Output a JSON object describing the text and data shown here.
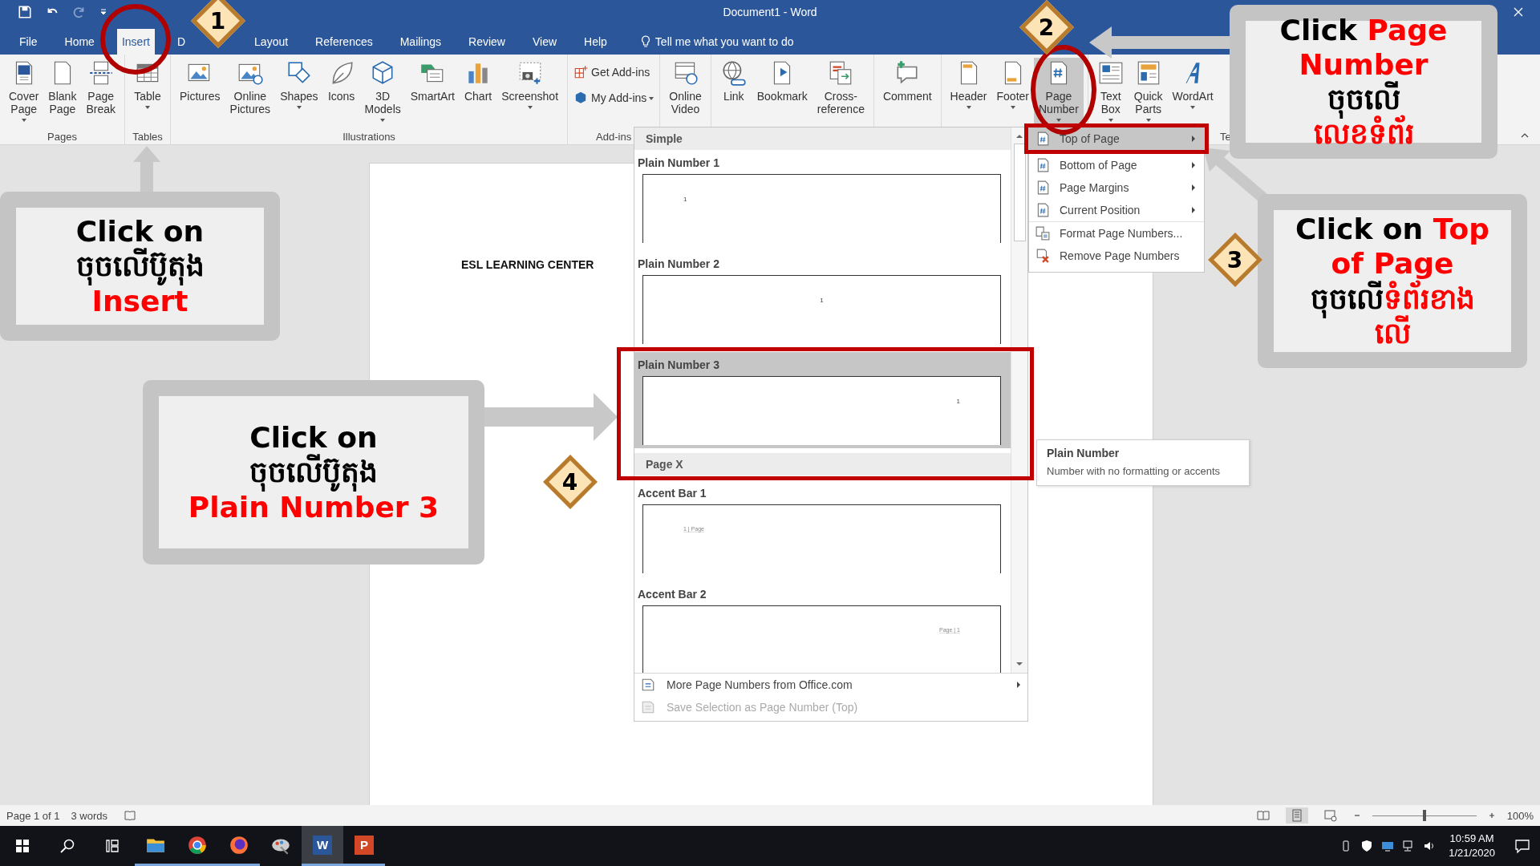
{
  "title_bar": {
    "title": "Document1  -  Word"
  },
  "tabs": [
    {
      "label": "File",
      "selected": false
    },
    {
      "label": "Home",
      "selected": false
    },
    {
      "label": "Insert",
      "selected": true
    },
    {
      "label": "D",
      "selected": false
    },
    {
      "label": "Layout",
      "selected": false
    },
    {
      "label": "References",
      "selected": false
    },
    {
      "label": "Mailings",
      "selected": false
    },
    {
      "label": "Review",
      "selected": false
    },
    {
      "label": "View",
      "selected": false
    },
    {
      "label": "Help",
      "selected": false
    }
  ],
  "tell_me": {
    "text": "Tell me what you want to do"
  },
  "ribbon": [
    {
      "label": "Pages",
      "kind": "large",
      "buttons": [
        {
          "label": "Cover Page",
          "dropdown": true,
          "pressed": false
        },
        {
          "label": "Blank Page",
          "dropdown": false,
          "pressed": false
        },
        {
          "label": "Page Break",
          "dropdown": false,
          "pressed": false
        }
      ]
    },
    {
      "label": "Tables",
      "kind": "large",
      "buttons": [
        {
          "label": "Table",
          "dropdown": true,
          "pressed": false
        }
      ]
    },
    {
      "label": "Illustrations",
      "kind": "large",
      "buttons": [
        {
          "label": "Pictures",
          "dropdown": false,
          "pressed": false
        },
        {
          "label": "Online Pictures",
          "dropdown": false,
          "pressed": false
        },
        {
          "label": "Shapes",
          "dropdown": true,
          "pressed": false
        },
        {
          "label": "Icons",
          "dropdown": false,
          "pressed": false
        },
        {
          "label": "3D Models",
          "dropdown": true,
          "pressed": false
        },
        {
          "label": "SmartArt",
          "dropdown": false,
          "pressed": false
        },
        {
          "label": "Chart",
          "dropdown": false,
          "pressed": false
        },
        {
          "label": "Screenshot",
          "dropdown": true,
          "pressed": false
        }
      ]
    },
    {
      "label": "Add-ins",
      "kind": "small",
      "buttons": [
        {
          "label": "Get Add-ins",
          "dropdown": false,
          "pressed": false
        },
        {
          "label": "My Add-ins",
          "dropdown": true,
          "pressed": false
        }
      ]
    },
    {
      "kind": "large",
      "buttons": [
        {
          "label": "Online Video",
          "dropdown": false,
          "pressed": false
        }
      ]
    },
    {
      "kind": "large",
      "buttons": [
        {
          "label": "Link",
          "dropdown": false,
          "pressed": false
        },
        {
          "label": "Bookmark",
          "dropdown": false,
          "pressed": false
        },
        {
          "label": "Cross-reference",
          "dropdown": false,
          "pressed": false
        }
      ]
    },
    {
      "kind": "large",
      "buttons": [
        {
          "label": "Comment",
          "dropdown": false,
          "pressed": false
        }
      ]
    },
    {
      "kind": "large",
      "buttons": [
        {
          "label": "Header",
          "dropdown": true,
          "pressed": false
        },
        {
          "label": "Footer",
          "dropdown": true,
          "pressed": false
        },
        {
          "label": "Page Number",
          "dropdown": true,
          "pressed": true
        }
      ]
    },
    {
      "label": "Te",
      "kind": "large",
      "buttons": [
        {
          "label": "Text Box",
          "dropdown": true,
          "pressed": false
        },
        {
          "label": "Quick Parts",
          "dropdown": true,
          "pressed": false
        },
        {
          "label": "WordArt",
          "dropdown": true,
          "pressed": false
        }
      ]
    }
  ],
  "document": {
    "text": "ESL LEARNING CENTER"
  },
  "gallery": {
    "sections": [
      {
        "title": "Simple",
        "items": [
          {
            "title": "Plain Number 1",
            "kind": "left",
            "preview": "1",
            "selected": false
          },
          {
            "title": "Plain Number 2",
            "kind": "center",
            "preview": "1",
            "selected": false
          },
          {
            "title": "Plain Number 3",
            "kind": "right",
            "preview": "1",
            "selected": true
          }
        ]
      },
      {
        "title": "Page X",
        "items": [
          {
            "title": "Accent Bar 1",
            "kind": "accent-left",
            "preview": "1 | Page",
            "selected": false
          },
          {
            "title": "Accent Bar 2",
            "kind": "accent-right",
            "preview": "Page | 1",
            "selected": false
          }
        ]
      }
    ],
    "footer": [
      {
        "label": "More Page Numbers from Office.com",
        "disabled": false,
        "submenu": true
      },
      {
        "label": "Save Selection as Page Number (Top)",
        "disabled": true,
        "submenu": false
      }
    ]
  },
  "submenu": [
    {
      "label": "Top of Page",
      "kind": "position",
      "selected": true,
      "submenu": true
    },
    {
      "label": "Bottom of Page",
      "kind": "position",
      "selected": false,
      "submenu": true
    },
    {
      "label": "Page Margins",
      "kind": "position",
      "selected": false,
      "submenu": true
    },
    {
      "label": "Current Position",
      "kind": "position",
      "selected": false,
      "submenu": true
    },
    {
      "label": "Format Page Numbers...",
      "kind": "format",
      "selected": false,
      "submenu": false
    },
    {
      "label": "Remove Page Numbers",
      "kind": "remove",
      "selected": false,
      "submenu": false
    }
  ],
  "tooltip": {
    "title": "Plain Number",
    "text": "Number with no formatting or accents"
  },
  "callouts": [
    {
      "lines": [
        [
          {
            "text": "Click on",
            "accent": false
          }
        ],
        [
          {
            "text": "ចុចលើប៊ូតុង",
            "accent": false
          }
        ],
        [
          {
            "text": "Insert",
            "accent": true
          }
        ]
      ]
    },
    {
      "lines": [
        [
          {
            "text": "Click ",
            "accent": false
          },
          {
            "text": "Page",
            "accent": true
          }
        ],
        [
          {
            "text": "Number",
            "accent": true
          }
        ],
        [
          {
            "text": "ចុចលើ",
            "accent": false
          }
        ],
        [
          {
            "text": "លេខទំព័រ",
            "accent": true
          }
        ]
      ]
    },
    {
      "lines": [
        [
          {
            "text": "Click on ",
            "accent": false
          },
          {
            "text": "Top",
            "accent": true
          }
        ],
        [
          {
            "text": "of Page",
            "accent": true
          }
        ],
        [
          {
            "text": "ចុចលើ",
            "accent": false
          },
          {
            "text": "ទំព័រខាង",
            "accent": true
          }
        ],
        [
          {
            "text": "លើ",
            "accent": true
          }
        ]
      ]
    },
    {
      "lines": [
        [
          {
            "text": "Click on",
            "accent": false
          }
        ],
        [
          {
            "text": "ចុចលើប៊ូតុង",
            "accent": false
          }
        ],
        [
          {
            "text": "Plain Number 3",
            "accent": true
          }
        ]
      ]
    }
  ],
  "step_badges": [
    "1",
    "2",
    "3",
    "4"
  ],
  "status_bar": {
    "page": "Page 1 of 1",
    "words": "3 words",
    "zoom": "100%",
    "zoom_slider": {
      "level": 0.5
    }
  },
  "taskbar": {
    "apps": [
      {
        "kind": "explorer",
        "running": true,
        "selected": false
      },
      {
        "kind": "chrome",
        "running": true,
        "selected": false
      },
      {
        "kind": "firefox",
        "running": true,
        "selected": false
      },
      {
        "kind": "paint",
        "running": false,
        "selected": false
      },
      {
        "kind": "word",
        "letter": "W",
        "running": true,
        "selected": true
      },
      {
        "kind": "powerpoint",
        "letter": "P",
        "running": true,
        "selected": false
      }
    ],
    "time": "10:59 AM",
    "date": "1/21/2020"
  }
}
